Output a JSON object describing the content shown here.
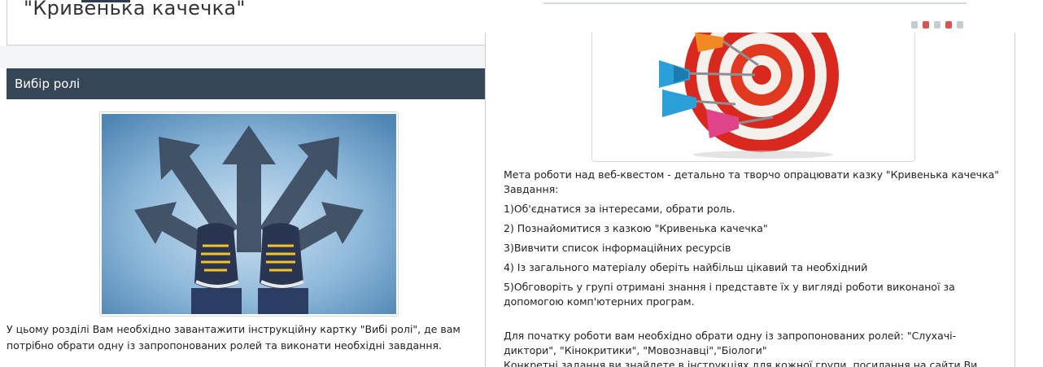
{
  "left_panel": {
    "page_title": "\"Кривенька качечка\"",
    "section_title": "Вибір ролі",
    "description": "У цьому розділі Вам необхідно завантажити інструкційну картку \"Вибі ролі\", де вам потрібно обрати одну із запропонованих ролей та виконати необхідні завдання."
  },
  "right_panel": {
    "goal_line": "Мета роботи над веб-квестом - детально та творчо опрацювати казку \"Кривенька качечка\"",
    "tasks_heading": "Завдання:",
    "tasks": [
      "1)Об'єднатися за інтересами, обрати роль.",
      "2) Познайомитися з казкою \"Кривенька качечка\"",
      "3)Вивчити список інформаційних ресурсів",
      "4) Із загального матеріалу оберіть найбільш цікавий та необхідний",
      "5)Обговоріть у групі отримані знання і представте їх у вигляді роботи виконаної за допомогою комп'ютерних програм."
    ],
    "roles_paragraph": "Для початку роботи вам необхідно обрати одну із запропонованих ролей: \"Слухачі-диктори\", \"Кінокритики\", \"Мовознавці\",\"Біологи\"",
    "cut_line": "Конкретні задання  ви знайдете в інструкціях для кожної групи, посилання на сайти Ви"
  },
  "colors": {
    "section_header_bg": "#354656",
    "dart_cyan": "#2a9fd8",
    "dart_pink": "#e0448a",
    "target_red": "#d9281e"
  }
}
